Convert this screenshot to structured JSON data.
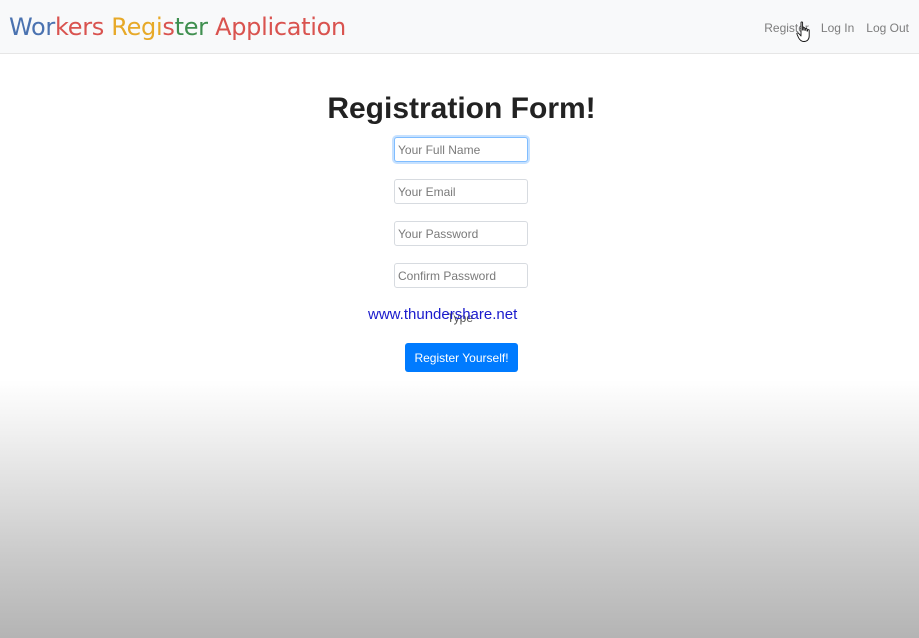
{
  "navbar": {
    "brand_segments": [
      {
        "text": "Wor",
        "color": "#4a72b0"
      },
      {
        "text": "kers ",
        "color": "#d9534f"
      },
      {
        "text": "Regi",
        "color": "#e7a928"
      },
      {
        "text": "s",
        "color": "#d9534f"
      },
      {
        "text": "t",
        "color": "#3f8f4f"
      },
      {
        "text": "er ",
        "color": "#3f8f4f"
      },
      {
        "text": "Application",
        "color": "#d9534f"
      }
    ],
    "links": [
      "Register",
      "Log In",
      "Log Out"
    ]
  },
  "form": {
    "title": "Registration Form!",
    "fields": {
      "full_name_placeholder": "Your Full Name",
      "email_placeholder": "Your Email",
      "password_placeholder": "Your Password",
      "confirm_password_placeholder": "Confirm Password"
    },
    "type_selected": "Type",
    "submit_label": "Register Yourself!"
  },
  "watermark": "www.thundershare.net",
  "colors": {
    "primary_button": "#007bff",
    "focus_border": "#80bdff",
    "watermark": "#1a1acc"
  }
}
